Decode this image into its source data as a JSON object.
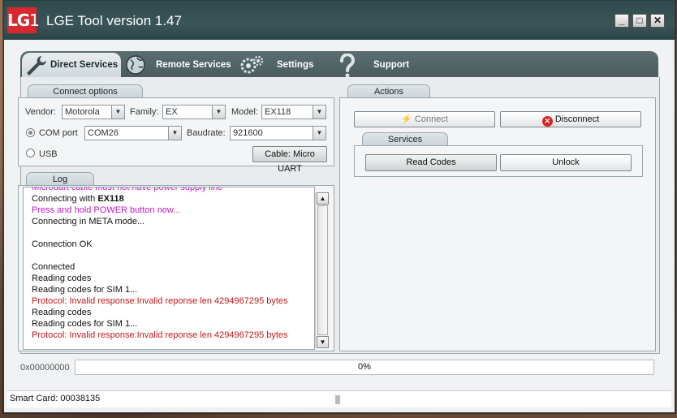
{
  "window": {
    "logo_text": "LG",
    "title": "LGE Tool version 1.47",
    "controls": [
      "_",
      "□",
      "✕"
    ]
  },
  "tabs": [
    {
      "label": "Direct Services",
      "icon": "wrench-icon",
      "active": true
    },
    {
      "label": "Remote Services",
      "icon": "globe-icon",
      "active": false
    },
    {
      "label": "Settings",
      "icon": "gears-icon",
      "active": false
    },
    {
      "label": "Support",
      "icon": "question-icon",
      "active": false
    }
  ],
  "connect_options": {
    "title": "Connect options",
    "vendor_label": "Vendor:",
    "vendor_value": "Motorola",
    "family_label": "Family:",
    "family_value": "EX",
    "model_label": "Model:",
    "model_value": "EX118",
    "com_port_label": "COM port",
    "com_port_value": "COM26",
    "baudrate_label": "Baudrate:",
    "baudrate_value": "921600",
    "usb_label": "USB",
    "cable_button": "Cable: Micro UART"
  },
  "actions": {
    "title": "Actions",
    "connect_label": "Connect",
    "disconnect_label": "Disconnect",
    "services_title": "Services",
    "read_codes_label": "Read Codes",
    "unlock_label": "Unlock"
  },
  "log": {
    "title": "Log",
    "lines": [
      {
        "text": "Microuart cable must not have power supply line",
        "color": "magenta"
      },
      {
        "text": "Connecting with ",
        "bold": "EX118",
        "color": "black"
      },
      {
        "text": "Press and hold POWER button now...",
        "color": "magenta"
      },
      {
        "text": "Connecting in META mode...",
        "color": "black"
      },
      {
        "text": "",
        "color": "black"
      },
      {
        "text": "Connection OK",
        "color": "black"
      },
      {
        "text": "",
        "color": "black"
      },
      {
        "text": "Connected",
        "color": "black"
      },
      {
        "text": "Reading codes",
        "color": "black"
      },
      {
        "text": "Reading codes for SIM 1...",
        "color": "black"
      },
      {
        "text": "Protocol: Invalid response:Invalid reponse len 4294967295 bytes",
        "color": "red"
      },
      {
        "text": "Reading codes",
        "color": "black"
      },
      {
        "text": "Reading codes for SIM 1...",
        "color": "black"
      },
      {
        "text": "Protocol: Invalid response:Invalid reponse len 4294967295 bytes",
        "color": "red"
      }
    ]
  },
  "address": "0x00000000",
  "progress_text": "0%",
  "progress_fraction": 0,
  "status": {
    "smart_card": "Smart Card: 00038135"
  },
  "colors": {
    "titlebar": "#3a5558",
    "logo": "#d8272f",
    "log_magenta": "#c01ac8",
    "log_red": "#c11818"
  }
}
